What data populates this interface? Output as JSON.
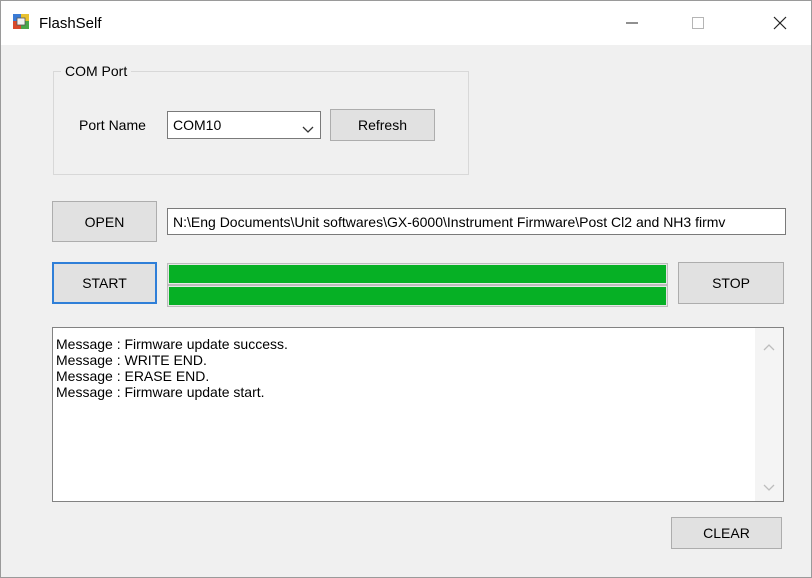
{
  "window": {
    "title": "FlashSelf"
  },
  "com_port": {
    "group_title": "COM Port",
    "port_name_label": "Port Name",
    "port_value": "COM10",
    "refresh_label": "Refresh"
  },
  "file": {
    "open_label": "OPEN",
    "path": "N:\\Eng Documents\\Unit softwares\\GX-6000\\Instrument Firmware\\Post Cl2 and NH3 firmv"
  },
  "flash": {
    "start_label": "START",
    "stop_label": "STOP",
    "progress_top": 1.0,
    "progress_bottom": 1.0
  },
  "messages": {
    "lines": [
      "Message : Firmware update success.",
      "Message : WRITE END.",
      "Message : ERASE END.",
      "Message : Firmware update start."
    ],
    "clear_label": "CLEAR"
  },
  "colors": {
    "progress": "#06b025",
    "focus": "#2f7fd8"
  }
}
